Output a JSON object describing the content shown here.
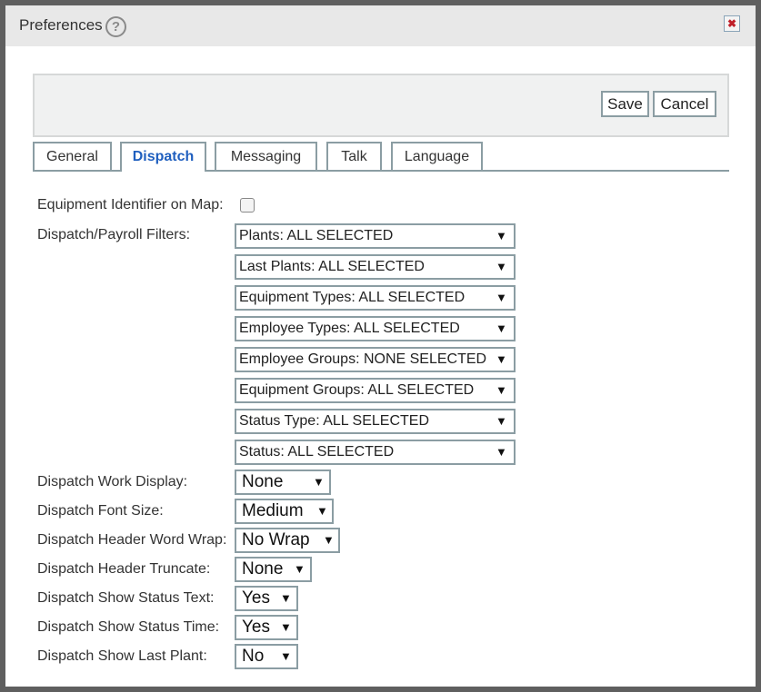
{
  "window": {
    "title": "Preferences",
    "close_symbol": "✖",
    "help_symbol": "?"
  },
  "toolbar": {
    "save_label": "Save",
    "cancel_label": "Cancel"
  },
  "tabs": [
    {
      "label": "General",
      "active": false
    },
    {
      "label": "Dispatch",
      "active": true
    },
    {
      "label": "Messaging",
      "active": false
    },
    {
      "label": "Talk",
      "active": false
    },
    {
      "label": "Language",
      "active": false
    }
  ],
  "form": {
    "equipment_identifier_label": "Equipment Identifier on Map:",
    "equipment_identifier_checked": false,
    "filters_label": "Dispatch/Payroll Filters:",
    "filters": [
      "Plants: ALL SELECTED",
      "Last Plants: ALL SELECTED",
      "Equipment Types: ALL SELECTED",
      "Employee Types: ALL SELECTED",
      "Employee Groups: NONE SELECTED",
      "Equipment Groups: ALL SELECTED",
      "Status Type: ALL SELECTED",
      "Status: ALL SELECTED"
    ],
    "settings": [
      {
        "label": "Dispatch Work Display:",
        "value": "None"
      },
      {
        "label": "Dispatch Font Size:",
        "value": "Medium"
      },
      {
        "label": "Dispatch Header Word Wrap:",
        "value": "No Wrap"
      },
      {
        "label": "Dispatch Header Truncate:",
        "value": "None"
      },
      {
        "label": "Dispatch Show Status Text:",
        "value": "Yes"
      },
      {
        "label": "Dispatch Show Status Time:",
        "value": "Yes"
      },
      {
        "label": "Dispatch Show Last Plant:",
        "value": "No"
      }
    ],
    "dropdown_arrow": "▼"
  },
  "colors": {
    "active_tab": "#1f5fbf",
    "border": "#8b9da3",
    "close_icon": "#c0202a"
  }
}
